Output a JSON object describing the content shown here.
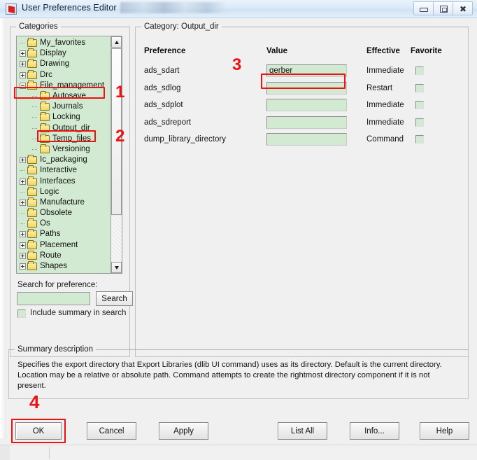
{
  "window": {
    "title": "User Preferences Editor",
    "icon": "app-flag-icon",
    "minimize_label": "–",
    "maximize_label": "□",
    "close_label": "✕"
  },
  "categories_group": {
    "label": "Categories",
    "tree": [
      {
        "label": "My_favorites",
        "level": 1,
        "expander": "none"
      },
      {
        "label": "Display",
        "level": 1,
        "expander": "plus"
      },
      {
        "label": "Drawing",
        "level": 1,
        "expander": "plus"
      },
      {
        "label": "Drc",
        "level": 1,
        "expander": "plus"
      },
      {
        "label": "File_management",
        "level": 1,
        "expander": "minus",
        "highlighted": true
      },
      {
        "label": "Autosave",
        "level": 2,
        "expander": "none"
      },
      {
        "label": "Journals",
        "level": 2,
        "expander": "none"
      },
      {
        "label": "Locking",
        "level": 2,
        "expander": "none"
      },
      {
        "label": "Output_dir",
        "level": 2,
        "expander": "none",
        "selected": true
      },
      {
        "label": "Temp_files",
        "level": 2,
        "expander": "none"
      },
      {
        "label": "Versioning",
        "level": 2,
        "expander": "none"
      },
      {
        "label": "Ic_packaging",
        "level": 1,
        "expander": "plus"
      },
      {
        "label": "Interactive",
        "level": 1,
        "expander": "none"
      },
      {
        "label": "Interfaces",
        "level": 1,
        "expander": "plus"
      },
      {
        "label": "Logic",
        "level": 1,
        "expander": "none"
      },
      {
        "label": "Manufacture",
        "level": 1,
        "expander": "plus"
      },
      {
        "label": "Obsolete",
        "level": 1,
        "expander": "none"
      },
      {
        "label": "Os",
        "level": 1,
        "expander": "none"
      },
      {
        "label": "Paths",
        "level": 1,
        "expander": "plus"
      },
      {
        "label": "Placement",
        "level": 1,
        "expander": "plus"
      },
      {
        "label": "Route",
        "level": 1,
        "expander": "plus"
      },
      {
        "label": "Shapes",
        "level": 1,
        "expander": "plus"
      }
    ],
    "search_label": "Search for preference:",
    "search_value": "",
    "search_placeholder": "",
    "search_button": "Search",
    "include_summary_label": "Include summary in search",
    "include_summary_checked": false
  },
  "category_panel": {
    "label": "Category:   Output_dir",
    "columns": [
      "Preference",
      "Value",
      "Effective",
      "Favorite"
    ],
    "rows": [
      {
        "preference": "ads_sdart",
        "value": "gerber",
        "effective": "Immediate",
        "favorite": false,
        "value_highlighted": true
      },
      {
        "preference": "ads_sdlog",
        "value": "",
        "effective": "Restart",
        "favorite": false
      },
      {
        "preference": "ads_sdplot",
        "value": "",
        "effective": "Immediate",
        "favorite": false
      },
      {
        "preference": "ads_sdreport",
        "value": "",
        "effective": "Immediate",
        "favorite": false
      },
      {
        "preference": "dump_library_directory",
        "value": "",
        "effective": "Command",
        "favorite": false
      }
    ]
  },
  "summary": {
    "label": "Summary description",
    "text": "Specifies the export directory that Export Libraries (dlib UI command) uses as its directory. Default is the current directory. Location may be a relative or absolute path. Command attempts to create the rightmost directory component if it is not present."
  },
  "buttons": {
    "ok": "OK",
    "cancel": "Cancel",
    "apply": "Apply",
    "list_all": "List All",
    "info": "Info...",
    "help": "Help"
  },
  "annotations": [
    {
      "number": "1",
      "target": "File_management tree item"
    },
    {
      "number": "2",
      "target": "Output_dir tree item"
    },
    {
      "number": "3",
      "target": "ads_sdart value field"
    },
    {
      "number": "4",
      "target": "OK button"
    }
  ],
  "colors": {
    "field_green": "#d2ead2",
    "annotation_red": "#ee1111",
    "dialog_face": "#f0f0f0",
    "titlebar_blue": "#dceaf7"
  }
}
